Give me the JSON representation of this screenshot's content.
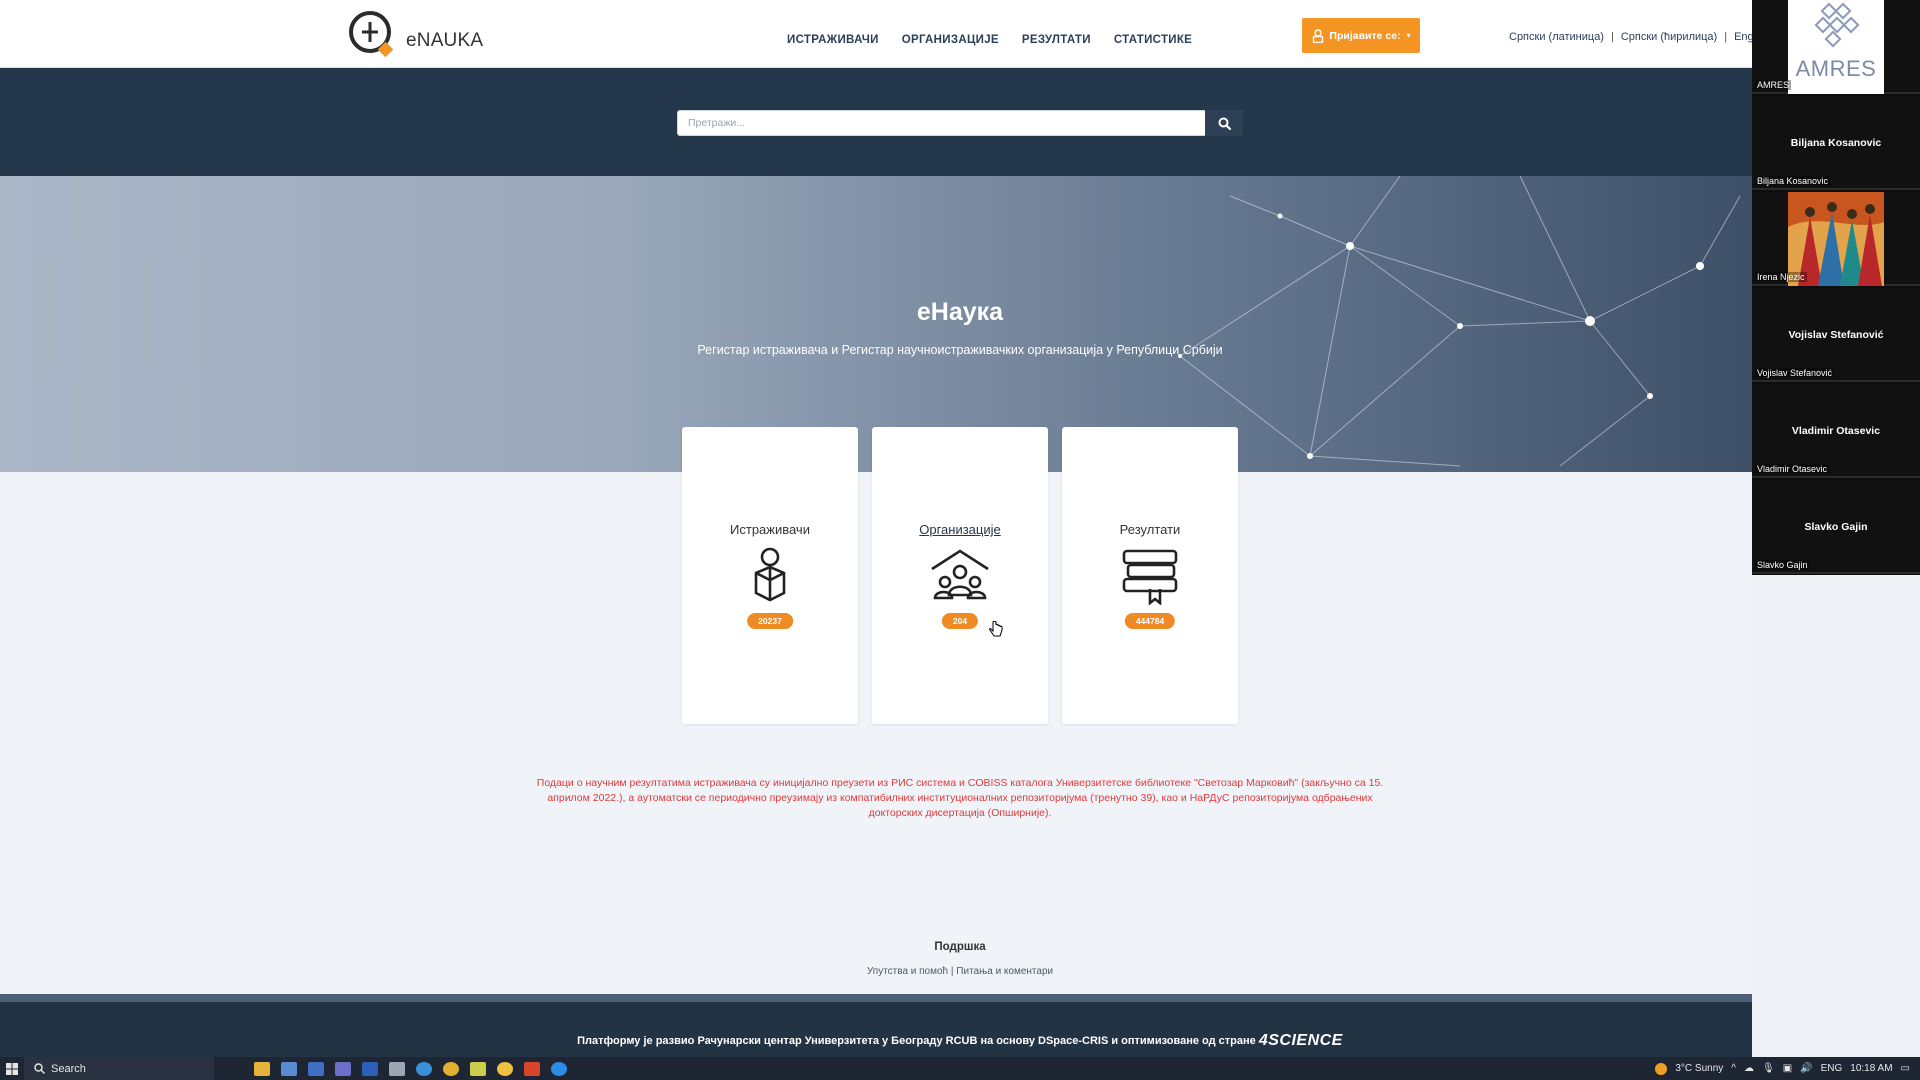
{
  "site": {
    "logo_text": "eNAUKA",
    "nav": [
      "ИСТРАЖИВАЧИ",
      "ОРГАНИЗАЦИЈЕ",
      "РЕЗУЛТАТИ",
      "СТАТИСТИКЕ"
    ],
    "login_label": "Пријавите се:",
    "languages": [
      "Српски (латиница)",
      "Српски (ћирилица)",
      "Engl"
    ],
    "search_placeholder": "Претражи..."
  },
  "hero": {
    "title": "eНаука",
    "subtitle": "Регистар истраживача и Регистар научноистраживачких организација у Републици Србији"
  },
  "cards": [
    {
      "title": "Истраживачи",
      "count": "20237",
      "icon": "researcher-icon"
    },
    {
      "title": "Организације",
      "count": "204",
      "icon": "organizations-icon"
    },
    {
      "title": "Резултати",
      "count": "444784",
      "icon": "results-icon"
    }
  ],
  "notice": {
    "text": "Подаци о научним резултатима истраживача су иницијално преузети из РИС система и COBISS каталога Универзитетске библиотеке \"Светозар Марковић\" (закључно са 15. априлом 2022.), а аутоматски се периодично преузимају из компатибилних институционалних репозиторијума (тренутно 39), као и НаРДуС репозиторијума одбрањених докторских дисертација (",
    "more": "Опширније",
    "close": ")."
  },
  "support": {
    "title": "Подршка",
    "help": "Упутства и помоћ",
    "separator": "|",
    "questions": "Питања и коментари"
  },
  "footer": {
    "text": "Платформу је развио Рачунарски центар Универзитета у Београду RCUB на основу DSpace-CRIS и оптимизоване од стране",
    "brand": "4SCIENCE"
  },
  "participants": [
    {
      "label": "AMRES",
      "center": "",
      "logo_text": "AMRES"
    },
    {
      "label": "Biljana Kosanovic",
      "center": "Biljana Kosanovic"
    },
    {
      "label": "Irena Njezic",
      "center": ""
    },
    {
      "label": "Vojislav Stefanović",
      "center": "Vojislav Stefanović"
    },
    {
      "label": "Vladimir Otasevic",
      "center": "Vladimir Otasevic"
    },
    {
      "label": "Slavko Gajin",
      "center": "Slavko Gajin"
    }
  ],
  "taskbar": {
    "search_label": "Search",
    "weather": "3°C  Sunny",
    "lang": "ENG",
    "time": "10:18 AM"
  },
  "colors": {
    "accent_orange": "#f39423",
    "navy": "#243649",
    "notice_red": "#e03a3a"
  }
}
